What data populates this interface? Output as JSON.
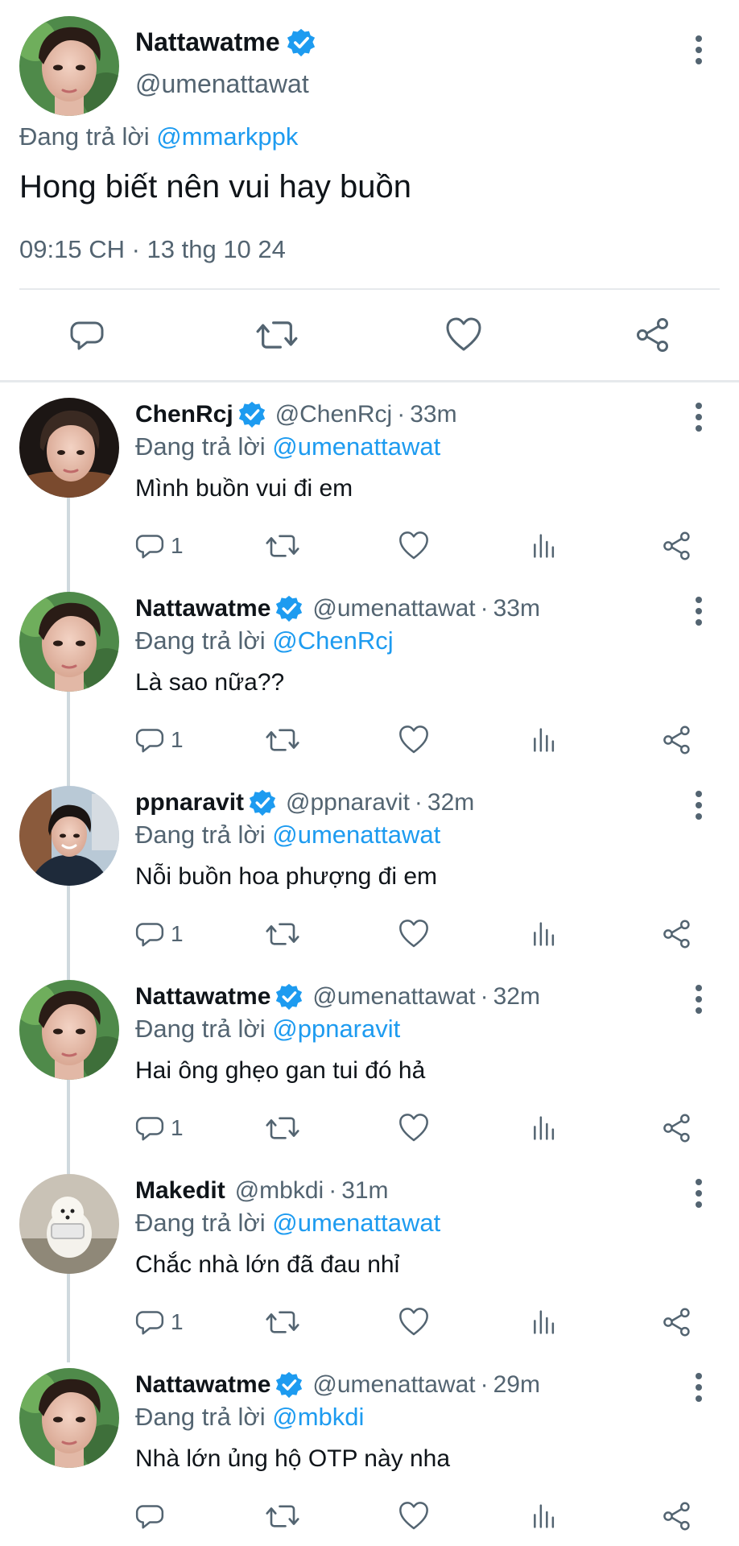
{
  "main_tweet": {
    "author_name": "Nattawatme",
    "author_handle": "@umenattawat",
    "replying_prefix": "Đang trả lời",
    "replying_to": "@mmarkppk",
    "text": "Hong biết nên vui hay buồn",
    "timestamp": "09:15 CH · 13 thg 10 24",
    "verified": true
  },
  "replies": [
    {
      "name": "ChenRcj",
      "handle": "@ChenRcj",
      "sep": "·",
      "time": "33m",
      "verified": true,
      "replying_prefix": "Đang trả lời",
      "replying_to": "@umenattawat",
      "text": " Mình buồn vui đi em",
      "reply_count": "1",
      "avatar": "avatar-chenrcj"
    },
    {
      "name": "Nattawatme",
      "handle": "@umenattawat",
      "sep": "·",
      "time": "33m",
      "verified": true,
      "replying_prefix": "Đang trả lời",
      "replying_to": "@ChenRcj",
      "text": "Là sao nữa??",
      "reply_count": "1",
      "avatar": "avatar-nattawatme"
    },
    {
      "name": "ppnaravit",
      "handle": "@ppnaravit",
      "sep": "·",
      "time": "32m",
      "verified": true,
      "replying_prefix": "Đang trả lời",
      "replying_to": "@umenattawat",
      "text": "Nỗi buồn hoa phượng đi em",
      "reply_count": "1",
      "avatar": "avatar-ppnaravit"
    },
    {
      "name": "Nattawatme",
      "handle": "@umenattawat",
      "sep": "·",
      "time": "32m",
      "verified": true,
      "replying_prefix": "Đang trả lời",
      "replying_to": "@ppnaravit",
      "text": "Hai ông ghẹo gan tui đó hả",
      "reply_count": "1",
      "avatar": "avatar-nattawatme"
    },
    {
      "name": "Makedit",
      "handle": "@mbkdi",
      "sep": "·",
      "time": "31m",
      "verified": false,
      "replying_prefix": "Đang trả lời",
      "replying_to": "@umenattawat",
      "text": "Chắc nhà lớn đã đau nhỉ",
      "reply_count": "1",
      "avatar": "avatar-makedit"
    },
    {
      "name": "Nattawatme",
      "handle": "@umenattawat",
      "sep": "·",
      "time": "29m",
      "verified": true,
      "replying_prefix": "Đang trả lời",
      "replying_to": "@mbkdi",
      "text": "Nhà lớn ủng hộ OTP này nha",
      "reply_count": "",
      "avatar": "avatar-nattawatme"
    }
  ],
  "icons": {
    "reply": "reply-icon",
    "retweet": "retweet-icon",
    "like": "like-icon",
    "views": "views-icon",
    "share": "share-icon",
    "more": "more-icon",
    "verified": "verified-badge-icon"
  },
  "colors": {
    "accent": "#1d9bf0",
    "text_primary": "#0f1419",
    "text_secondary": "#536471",
    "divider": "#e6e9ec",
    "thread_line": "#cfd9de"
  }
}
